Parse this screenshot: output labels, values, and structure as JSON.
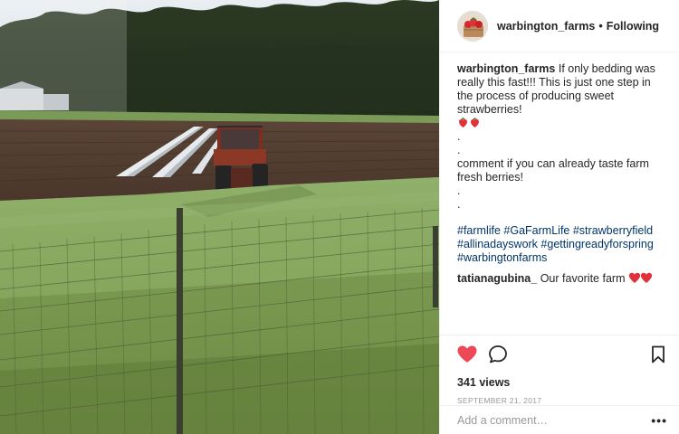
{
  "post": {
    "username": "warbington_farms",
    "separator": "•",
    "follow_status": "Following",
    "avatar_icon": "strawberry-basket-avatar-icon"
  },
  "caption": {
    "username": "warbington_farms",
    "text_1": "If only bedding was really this fast!!! This is just one step in the process of producing sweet strawberries!",
    "emoji": "strawberry-emoji",
    "dot_1": ".",
    "dot_2": ".",
    "text_2": "comment if you can already taste farm fresh berries!",
    "dot_3": ".",
    "dot_4": ".",
    "hashtags": [
      "#farmlife",
      "#GaFarmLife",
      "#strawberryfield",
      "#allinadayswork",
      "#gettingreadyforspring",
      "#warbingtonfarms"
    ]
  },
  "comment": {
    "username": "tatianagubina_",
    "text": "Our favorite farm",
    "emoji": "two-hearts-emoji"
  },
  "actions": {
    "like_icon": "heart-filled-icon",
    "comment_icon": "comment-bubble-icon",
    "save_icon": "bookmark-icon",
    "liked_color": "#ed4956"
  },
  "stats": {
    "views": "341 views",
    "date": "SEPTEMBER 21, 2017"
  },
  "add_comment": {
    "placeholder": "Add a comment…",
    "more_label": "•••"
  }
}
